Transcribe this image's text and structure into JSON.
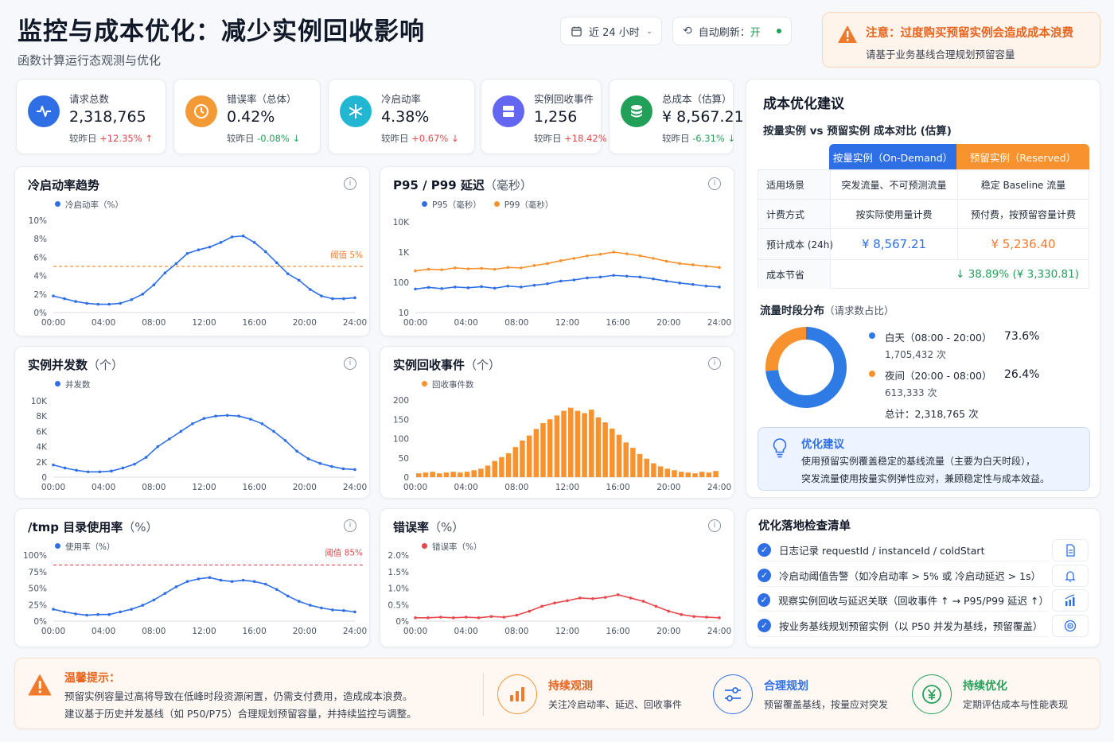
{
  "header": {
    "title": "监控与成本优化：减少实例回收影响",
    "subtitle": "函数计算运行态观测与优化",
    "range": "近 24 小时",
    "refresh_label": "自动刷新：",
    "refresh_value": "开"
  },
  "alert": {
    "title": "注意：过度购买预留实例会造成成本浪费",
    "body": "请基于业务基线合理规划预留容量"
  },
  "kpis": [
    {
      "label": "请求总数",
      "value": "2,318,765",
      "cmp_label": "较昨日",
      "delta": "+12.35%",
      "arrow": "↑",
      "color": "#2f6fe6",
      "icon": "pulse-icon"
    },
    {
      "label": "错误率（总体）",
      "value": "0.42%",
      "cmp_label": "较昨日",
      "delta": "-0.08%",
      "arrow": "↓",
      "color": "#f39a37",
      "icon": "clock-icon"
    },
    {
      "label": "冷启动率",
      "value": "4.38%",
      "cmp_label": "较昨日",
      "delta": "+0.67%",
      "arrow": "↓",
      "color": "#21b6d1",
      "icon": "snowflake-icon"
    },
    {
      "label": "实例回收事件",
      "value": "1,256",
      "cmp_label": "较昨日",
      "delta": "+18.42%",
      "arrow": "",
      "color": "#6366f1",
      "icon": "server-icon"
    },
    {
      "label": "总成本（估算）",
      "value": "¥ 8,567.21",
      "cmp_label": "较昨日",
      "delta": "-6.31%",
      "arrow": "↓",
      "color": "#22a05a",
      "icon": "database-icon"
    }
  ],
  "charts": {
    "xticks": [
      "00:00",
      "04:00",
      "08:00",
      "12:00",
      "16:00",
      "20:00",
      "24:00"
    ],
    "cold": {
      "title": "冷启动率趋势",
      "legend": "冷启动率（%）",
      "yticks": [
        "10%",
        "8%",
        "6%",
        "4%",
        "2%",
        "0%"
      ],
      "threshold_label": "阈值 5%"
    },
    "latency": {
      "title": "P95 / P99 延迟",
      "unit": "（毫秒）",
      "legend_p95": "P95（毫秒）",
      "legend_p99": "P99（毫秒）",
      "yticks": [
        "10K",
        "1K",
        "100",
        "10"
      ]
    },
    "concurrency": {
      "title": "实例并发数",
      "unit": "（个）",
      "legend": "并发数",
      "yticks": [
        "10K",
        "8K",
        "6K",
        "4K",
        "2K",
        "0"
      ]
    },
    "recycle": {
      "title": "实例回收事件",
      "unit": "（个）",
      "legend": "回收事件数",
      "yticks": [
        "200",
        "150",
        "100",
        "50",
        "0"
      ]
    },
    "tmp": {
      "title": "/tmp 目录使用率",
      "unit": "（%）",
      "legend": "使用率（%）",
      "yticks": [
        "100%",
        "75%",
        "50%",
        "25%",
        "0%"
      ],
      "threshold_label": "阈值 85%"
    },
    "error": {
      "title": "错误率",
      "unit": "（%）",
      "legend": "错误率（%）",
      "yticks": [
        "2.0%",
        "1.5%",
        "1.0%",
        "0.5%",
        "0%"
      ]
    }
  },
  "chart_data": [
    {
      "type": "line",
      "title": "冷启动率趋势",
      "series": [
        {
          "name": "冷启动率（%）",
          "values": [
            1.8,
            1.5,
            1.2,
            1.0,
            0.9,
            0.9,
            1.0,
            1.4,
            2.0,
            3.0,
            4.3,
            5.3,
            6.4,
            6.8,
            7.1,
            7.6,
            8.2,
            8.3,
            7.6,
            6.6,
            5.4,
            4.2,
            3.5,
            2.5,
            1.8,
            1.5,
            1.5,
            1.6
          ]
        }
      ],
      "x_range": [
        "00:00",
        "24:00"
      ],
      "ylim": [
        0,
        10
      ],
      "threshold": 5
    },
    {
      "type": "line",
      "title": "P95 / P99 延迟（毫秒）",
      "log_scale": true,
      "series": [
        {
          "name": "P95（毫秒）",
          "values": [
            60,
            68,
            62,
            70,
            66,
            72,
            64,
            75,
            70,
            80,
            90,
            110,
            120,
            140,
            150,
            170,
            160,
            150,
            130,
            110,
            95,
            85,
            75,
            70
          ]
        },
        {
          "name": "P99（毫秒）",
          "values": [
            240,
            270,
            260,
            300,
            280,
            290,
            270,
            310,
            300,
            360,
            420,
            520,
            620,
            750,
            850,
            1000,
            880,
            760,
            620,
            500,
            420,
            380,
            340,
            310
          ]
        }
      ],
      "x_range": [
        "00:00",
        "24:00"
      ],
      "ylim": [
        10,
        10000
      ]
    },
    {
      "type": "line",
      "title": "实例并发数（个）",
      "series": [
        {
          "name": "并发数",
          "values": [
            1600,
            1200,
            900,
            700,
            700,
            800,
            1200,
            1700,
            2600,
            4000,
            5000,
            6000,
            7000,
            7700,
            8000,
            8100,
            8000,
            7600,
            7000,
            6000,
            4800,
            3400,
            2400,
            1800,
            1400,
            1100,
            1000
          ]
        }
      ],
      "x_range": [
        "00:00",
        "24:00"
      ],
      "ylim": [
        0,
        10000
      ]
    },
    {
      "type": "bar",
      "title": "实例回收事件（个）",
      "series": [
        {
          "name": "回收事件数",
          "values": [
            10,
            12,
            14,
            10,
            12,
            14,
            12,
            14,
            18,
            22,
            30,
            42,
            52,
            62,
            78,
            95,
            108,
            125,
            140,
            150,
            160,
            172,
            180,
            172,
            166,
            175,
            155,
            142,
            126,
            110,
            90,
            76,
            60,
            48,
            36,
            28,
            22,
            18,
            14,
            12,
            10,
            14,
            12,
            16
          ]
        }
      ],
      "x_range": [
        "00:00",
        "24:00"
      ],
      "ylim": [
        0,
        200
      ]
    },
    {
      "type": "line",
      "title": "/tmp 目录使用率（%）",
      "series": [
        {
          "name": "使用率（%）",
          "values": [
            18,
            14,
            11,
            9,
            10,
            10,
            14,
            18,
            24,
            32,
            42,
            52,
            60,
            64,
            66,
            62,
            60,
            62,
            60,
            56,
            48,
            38,
            30,
            24,
            20,
            17,
            16,
            14
          ]
        }
      ],
      "x_range": [
        "00:00",
        "24:00"
      ],
      "ylim": [
        0,
        100
      ],
      "threshold": 85
    },
    {
      "type": "line",
      "title": "错误率（%）",
      "series": [
        {
          "name": "错误率（%）",
          "values": [
            0.1,
            0.1,
            0.12,
            0.1,
            0.12,
            0.1,
            0.14,
            0.12,
            0.18,
            0.3,
            0.45,
            0.55,
            0.62,
            0.7,
            0.68,
            0.72,
            0.8,
            0.7,
            0.6,
            0.45,
            0.3,
            0.2,
            0.14,
            0.12,
            0.1
          ]
        }
      ],
      "x_range": [
        "00:00",
        "24:00"
      ],
      "ylim": [
        0,
        2
      ]
    },
    {
      "type": "pie",
      "title": "流量时段分布",
      "categories": [
        "白天（08:00 - 20:00）",
        "夜间（20:00 - 08:00）"
      ],
      "values": [
        73.6,
        26.4
      ],
      "colors": [
        "#2f7be6",
        "#f7922e"
      ]
    }
  ],
  "cost": {
    "title": "成本优化建议",
    "subtitle": "按量实例 vs 预留实例 成本对比 (估算)",
    "col1": "按量实例（On-Demand）",
    "col2": "预留实例（Reserved）",
    "rows": [
      {
        "label": "适用场景",
        "a": "突发流量、不可预测流量",
        "b": "稳定 Baseline 流量"
      },
      {
        "label": "计费方式",
        "a": "按实际使用量计费",
        "b": "预付费，按预留容量计费"
      },
      {
        "label": "预计成本 (24h)",
        "a": "¥ 8,567.21",
        "b": "¥ 5,236.40"
      }
    ],
    "saving_label": "成本节省",
    "saving_value": "↓ 38.89% (¥ 3,330.81)"
  },
  "traffic": {
    "title": "流量时段分布",
    "unit": "（请求数占比）",
    "day_label": "白天（08:00 - 20:00）",
    "day_count": "1,705,432 次",
    "day_pct": "73.6%",
    "night_label": "夜间（20:00 - 08:00）",
    "night_count": "613,333 次",
    "night_pct": "26.4%",
    "total": "总计：2,318,765 次"
  },
  "suggest": {
    "title": "优化建议",
    "body1": "使用预留实例覆盖稳定的基线流量（主要为白天时段），",
    "body2": "突发流量使用按量实例弹性应对，兼顾稳定性与成本效益。"
  },
  "checklist": {
    "title": "优化落地检查清单",
    "items": [
      "日志记录 requestId / instanceId / coldStart",
      "冷启动阈值告警（如冷启动率 > 5% 或 冷启动延迟 > 1s）",
      "观察实例回收与延迟关联（回收事件 ↑ → P95/P99 延迟 ↑）",
      "按业务基线规划预留实例（以 P50 并发为基线，预留覆盖）"
    ]
  },
  "footer": {
    "tip_title": "温馨提示：",
    "tip1": "预留实例容量过高将导致在低峰时段资源闲置，仍需支付费用，造成成本浪费。",
    "tip2": "建议基于历史并发基线（如 P50/P75）合理规划预留容量，并持续监控与调整。",
    "items": [
      {
        "title": "持续观测",
        "desc": "关注冷启动率、延迟、回收事件"
      },
      {
        "title": "合理规划",
        "desc": "预留覆盖基线，按量应对突发"
      },
      {
        "title": "持续优化",
        "desc": "定期评估成本与性能表现"
      }
    ]
  }
}
